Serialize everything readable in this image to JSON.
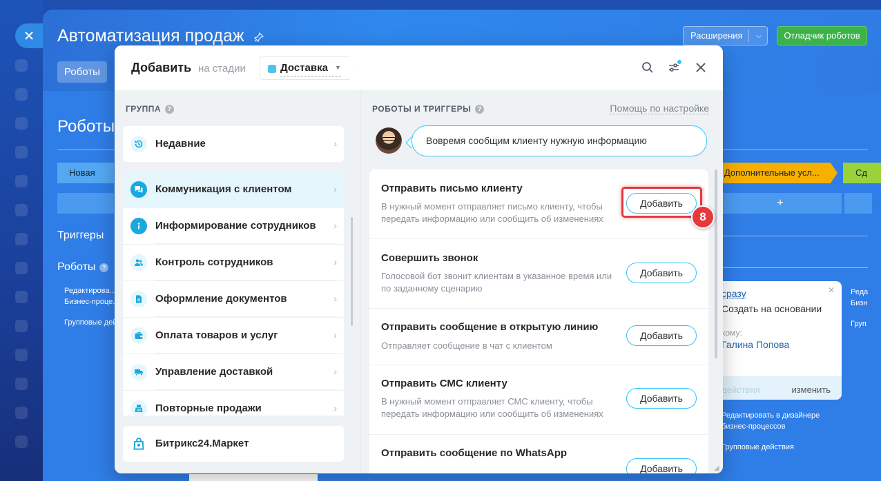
{
  "background": {
    "app_title": "Автоматизация продаж",
    "tab_robots": "Роботы",
    "extensions_label": "Расширения",
    "debugger_label": "Отладчик роботов",
    "heading_robots": "Роботы",
    "stage_new": "Новая",
    "stage_extra": "Дополнительные усл...",
    "stage_green": "Сд",
    "triggers_label": "Триггеры",
    "robots_label": "Роботы",
    "edit_bp_left": "Редактирова...",
    "bp_left": "Бизнес-проце...",
    "group_actions_left": "Групповые дей...",
    "edit_bp_right": "Редактировать в дизайнере",
    "bp_right": "бизнес-процессов",
    "group_actions_right": "Групповые действия",
    "edge_edit": "Реда",
    "edge_bp": "Бизн",
    "edge_group": "Груп",
    "card": {
      "link": "сразу",
      "text": "Создать на основании",
      "sub": "кому:",
      "user": "Галина Попова",
      "actions": "действия",
      "edit": "изменить"
    }
  },
  "modal": {
    "title": "Добавить",
    "stage_label": "на стадии",
    "stage_value": "Доставка",
    "group_header": "ГРУППА",
    "robots_header": "РОБОТЫ И ТРИГГЕРЫ",
    "help_link": "Помощь по настройке",
    "bubble_text": "Вовремя сообщим клиенту нужную информацию",
    "recent": "Недавние",
    "groups": [
      "Коммуникация с клиентом",
      "Информирование сотрудников",
      "Контроль сотрудников",
      "Оформление документов",
      "Оплата товаров и услуг",
      "Управление доставкой",
      "Повторные продажи"
    ],
    "market": "Битрикс24.Маркет",
    "robots": [
      {
        "title": "Отправить письмо клиенту",
        "desc": "В нужный момент отправляет письмо клиенту, чтобы передать информацию или сообщить об изменениях",
        "button": "Добавить"
      },
      {
        "title": "Совершить звонок",
        "desc": "Голосовой бот звонит клиентам в указанное время или по заданному сценарию",
        "button": "Добавить"
      },
      {
        "title": "Отправить сообщение в открытую линию",
        "desc": "Отправляет сообщение в чат с клиентом",
        "button": "Добавить"
      },
      {
        "title": "Отправить СМС клиенту",
        "desc": "В нужный момент отправляет СМС клиенту, чтобы передать информацию или сообщить об изменениях",
        "button": "Добавить"
      },
      {
        "title": "Отправить сообщение по WhatsApp",
        "desc": "",
        "button": "Добавить"
      }
    ],
    "step_badge": "8"
  },
  "icons": {
    "close": "close-icon",
    "search": "search-icon",
    "filter": "filter-icon"
  },
  "colors": {
    "accent": "#2fc6f6",
    "highlight": "#e5393e",
    "debugger_green": "#3bb34a"
  }
}
